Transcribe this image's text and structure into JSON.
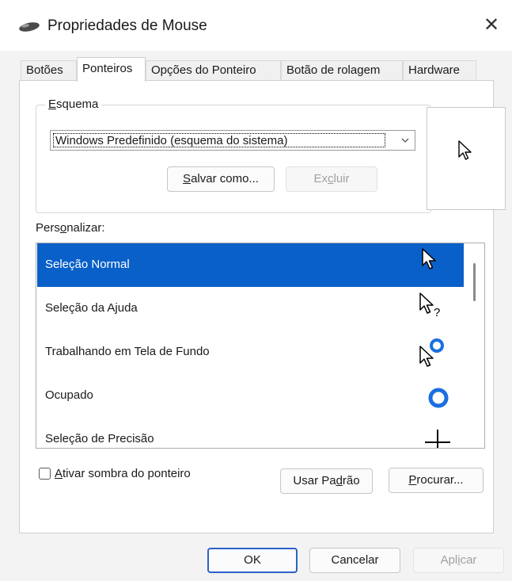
{
  "window": {
    "title": "Propriedades de Mouse",
    "icon": "mouse-icon",
    "close_glyph": "✕"
  },
  "tabs": [
    {
      "label": "Botões",
      "active": false
    },
    {
      "label": "Ponteiros",
      "active": true
    },
    {
      "label": "Opções do Ponteiro",
      "active": false
    },
    {
      "label": "Botão de rolagem",
      "active": false
    },
    {
      "label": "Hardware",
      "active": false
    }
  ],
  "scheme": {
    "legend_u": "E",
    "legend_rest": "squema",
    "selected": "Windows Predefinido (esquema do sistema)",
    "save_as_u": "S",
    "save_as_rest": "alvar como...",
    "delete_pre": "Ex",
    "delete_u": "c",
    "delete_rest": "luir"
  },
  "preview": {
    "icon": "arrow-pointer-icon"
  },
  "customize": {
    "label_pre": "Pers",
    "label_u": "o",
    "label_rest": "nalizar:",
    "items": [
      {
        "label": "Seleção Normal",
        "icon": "arrow-pointer-icon",
        "selected": true
      },
      {
        "label": "Seleção da Ajuda",
        "icon": "help-pointer-icon",
        "selected": false
      },
      {
        "label": "Trabalhando em Tela de Fundo",
        "icon": "working-pointer-icon",
        "selected": false
      },
      {
        "label": "Ocupado",
        "icon": "busy-ring-icon",
        "selected": false
      },
      {
        "label": "Seleção de Precisão",
        "icon": "crosshair-icon",
        "selected": false
      }
    ]
  },
  "shadow": {
    "checked": false,
    "label_u": "A",
    "label_rest": "tivar sombra do ponteiro"
  },
  "use_default": {
    "pre": "Usar Pa",
    "u": "d",
    "rest": "rão"
  },
  "browse": {
    "u": "P",
    "rest": "rocurar..."
  },
  "footer": {
    "ok": "OK",
    "cancel": "Cancelar",
    "apply_pre": "Apl",
    "apply_u": "i",
    "apply_rest": "car"
  },
  "colors": {
    "selection": "#0a60c9",
    "busy_ring": "#1b6fe0",
    "default_button_border": "#2b62c7"
  }
}
